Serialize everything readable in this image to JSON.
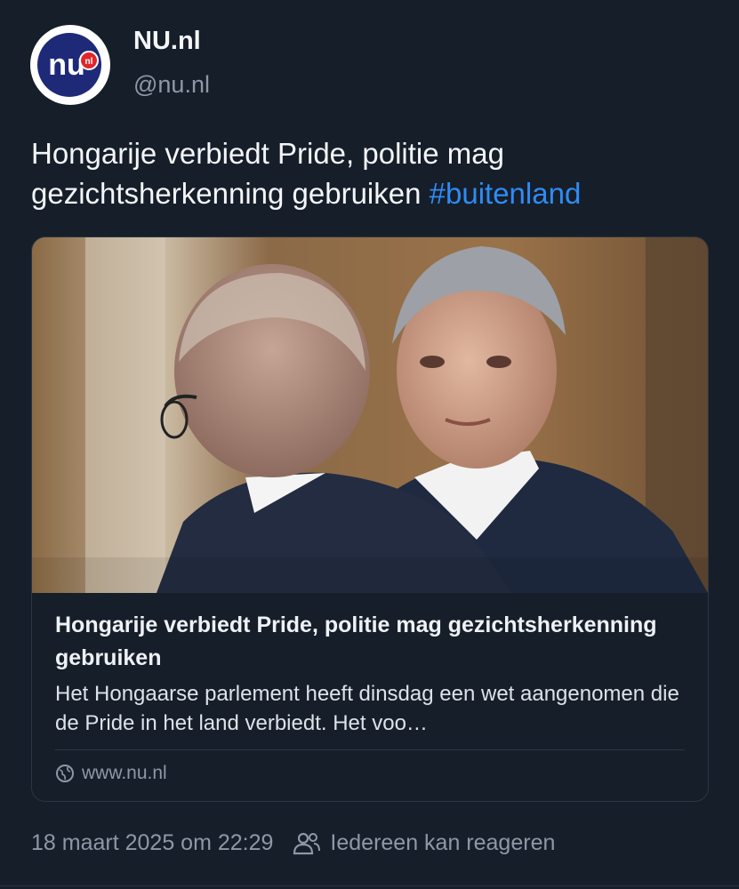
{
  "author": {
    "display_name": "NU.nl",
    "handle": "@nu.nl",
    "avatar_icon": "nu-nl-logo-icon",
    "avatar_logo_text": "nu",
    "avatar_logo_badge": "nl"
  },
  "post": {
    "text": "Hongarije verbiedt Pride, politie mag gezichtsherkenning gebruiken",
    "hashtag": "#buitenland"
  },
  "link_card": {
    "image_icon": "news-photo",
    "title": "Hongarije verbiedt Pride, politie mag gezichtsherkenning gebruiken",
    "description": "Het Hongaarse parlement heeft dinsdag een wet aangenomen die de Pride in het land verbiedt. Het voo…",
    "domain_icon": "globe-icon",
    "domain": "www.nu.nl"
  },
  "footer": {
    "timestamp": "18 maart 2025 om 22:29",
    "reply_icon": "people-icon",
    "reply_setting": "Iedereen kan reageren"
  },
  "colors": {
    "background": "#161e29",
    "link": "#2f8cf4",
    "secondary_text": "#8d98a7",
    "logo_navy": "#1e2a78",
    "logo_red": "#e0262b"
  }
}
